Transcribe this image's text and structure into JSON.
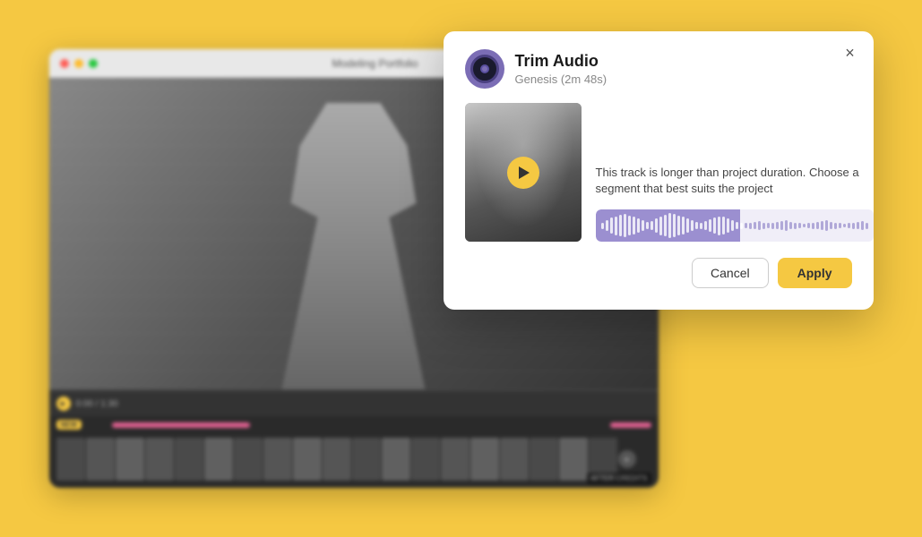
{
  "background_color": "#F5C842",
  "app_window": {
    "title": "Modeling Portfolio",
    "traffic_lights": [
      "#FF5F57",
      "#FEBC2E",
      "#28C840"
    ]
  },
  "modal": {
    "title": "Trim Audio",
    "subtitle": "Genesis",
    "duration": "(2m 48s)",
    "description": "This track is longer than project duration. Choose a segment that best suits the project",
    "cancel_label": "Cancel",
    "apply_label": "Apply",
    "close_label": "×"
  },
  "waveform": {
    "selected_width_pct": 52,
    "bars": [
      8,
      14,
      20,
      24,
      28,
      30,
      26,
      22,
      18,
      14,
      10,
      12,
      18,
      24,
      28,
      32,
      30,
      26,
      22,
      18,
      14,
      10,
      8,
      12,
      16,
      20,
      24,
      22,
      18,
      14,
      10,
      8,
      6,
      8,
      10,
      12,
      8,
      6,
      8,
      10,
      12,
      14,
      10,
      8,
      6,
      4,
      6,
      8,
      10,
      12,
      14,
      10,
      8,
      6,
      4,
      6,
      8,
      10,
      12,
      8
    ]
  }
}
